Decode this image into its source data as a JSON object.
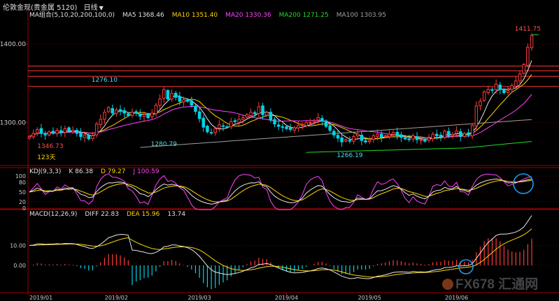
{
  "title": {
    "instrument": "伦敦金现(贵金属 5120)",
    "period": "日线"
  },
  "colors": {
    "up": "#ff3b3b",
    "down": "#00d4e6",
    "line": "#ff3232",
    "axis": "#a00000"
  },
  "price_panel": {
    "header": [
      {
        "label": "MA组合(5,10,20,200,100,0)",
        "color": "#e0e0e0"
      },
      {
        "label": "MA5 1368.46",
        "color": "#e0e0e0"
      },
      {
        "label": "MA10 1351.40",
        "color": "#ffd700"
      },
      {
        "label": "MA20 1330.36",
        "color": "#ff44ff"
      },
      {
        "label": "MA200 1271.25",
        "color": "#22dd22"
      },
      {
        "label": "MA100 1303.95",
        "color": "#a0a0a0"
      }
    ],
    "y_ticks": [
      "1400.00",
      "1300.00"
    ],
    "annotations": [
      {
        "text": "1346.73",
        "color": "#ff5050"
      },
      {
        "text": "1276.10",
        "color": "#40e0f0"
      },
      {
        "text": "123天",
        "color": "#ffd700"
      },
      {
        "text": "1280.79",
        "color": "#40e0f0"
      },
      {
        "text": "1266.19",
        "color": "#40e0f0"
      },
      {
        "text": "1411.75",
        "color": "#ff5050"
      }
    ]
  },
  "kdj_panel": {
    "header": [
      {
        "label": "KDJ(9,3,3)",
        "color": "#e0e0e0"
      },
      {
        "label": "K 86.38",
        "color": "#e0e0e0"
      },
      {
        "label": "D 79.27",
        "color": "#ffd700"
      },
      {
        "label": "J 100.59",
        "color": "#ff44ff"
      }
    ],
    "y_ticks": [
      "100",
      "80",
      "50",
      "20",
      "0"
    ]
  },
  "macd_panel": {
    "header": [
      {
        "label": "MACD(12,26,9)",
        "color": "#e0e0e0"
      },
      {
        "label": "DIFF 22.83",
        "color": "#e0e0e0"
      },
      {
        "label": "DEA 15.96",
        "color": "#ffd700"
      },
      {
        "label": "13.74",
        "color": "#e0e0e0"
      }
    ],
    "y_ticks": [
      "10.00",
      "0.00"
    ]
  },
  "x_ticks": [
    "2019/01",
    "2019/02",
    "2019/03",
    "2019/04",
    "2019/05",
    "2019/06"
  ],
  "watermark": "FX678 汇通网",
  "chart_data": {
    "type": "candlestick",
    "x_range": [
      "2019/01",
      "2019/06"
    ],
    "price": {
      "ylim": [
        1245,
        1435
      ],
      "hlines": [
        1412,
        1372,
        1366,
        1359,
        1346
      ],
      "swing_points": [
        {
          "label": "1276.10",
          "value": 1276.1
        },
        {
          "label": "1346.73",
          "value": 1346.73
        },
        {
          "label": "1280.79",
          "value": 1280.79
        },
        {
          "label": "1266.19",
          "value": 1266.19
        },
        {
          "label": "1411.75",
          "value": 1411.75
        }
      ]
    },
    "close": [
      1282,
      1286,
      1291,
      1286,
      1284,
      1288,
      1287,
      1290,
      1287,
      1292,
      1289,
      1290,
      1286,
      1282,
      1284,
      1279,
      1283,
      1298,
      1304,
      1313,
      1319,
      1312,
      1316,
      1314,
      1312,
      1309,
      1313,
      1312,
      1308,
      1310,
      1306,
      1312,
      1322,
      1330,
      1342,
      1330,
      1337,
      1332,
      1327,
      1329,
      1327,
      1322,
      1314,
      1305,
      1294,
      1288,
      1287,
      1292,
      1297,
      1295,
      1294,
      1301,
      1301,
      1304,
      1306,
      1310,
      1313,
      1311,
      1320,
      1310,
      1313,
      1303,
      1298,
      1295,
      1294,
      1292,
      1291,
      1293,
      1296,
      1297,
      1300,
      1300,
      1302,
      1306,
      1302,
      1295,
      1290,
      1284,
      1280,
      1275,
      1278,
      1276,
      1282,
      1285,
      1277,
      1275,
      1277,
      1283,
      1285,
      1281,
      1283,
      1285,
      1287,
      1283,
      1281,
      1279,
      1278,
      1283,
      1278,
      1278,
      1276,
      1280,
      1285,
      1283,
      1282,
      1289,
      1283,
      1285,
      1289,
      1282,
      1286,
      1284,
      1296,
      1321,
      1327,
      1339,
      1342,
      1341,
      1349,
      1342,
      1338,
      1341,
      1347,
      1353,
      1362,
      1374,
      1396,
      1411
    ]
  }
}
